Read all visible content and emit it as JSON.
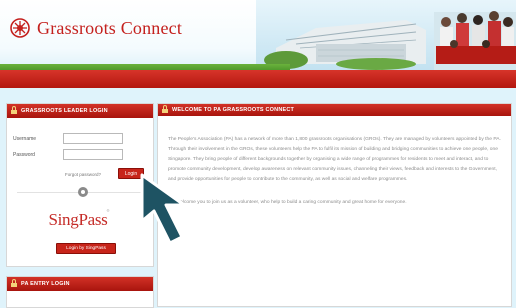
{
  "header": {
    "site_name": "Grassroots Connect"
  },
  "login_panel": {
    "title": "GRASSROOTS LEADER LOGIN",
    "username_label": "Username",
    "password_label": "Password",
    "forgot_text": "Forgot password?",
    "login_button": "Login",
    "singpass_logo": "SingPass",
    "singpass_button": "Login by SingPass"
  },
  "second_panel": {
    "title": "PA ENTRY LOGIN"
  },
  "welcome_panel": {
    "title": "WELCOME TO PA GRASSROOTS CONNECT",
    "paragraph_1": "The People's Association (PA) has a network of more than 1,800 grassroots organisations (GROs). They are managed by volunteers appointed by the PA. Through their involvement in the GROs, these volunteers help the PA to fulfil its mission of building and bridging communities to achieve one people, one Singapore. They bring people of different backgrounds together by organising a wide range of programmes for residents to meet and interact, and to promote community development, develop awareness on relevant community issues, channeling their views, feedback and interests to the Government, and provide opportunities for people to contribute to the community, as well as social and welfare programmes.",
    "paragraph_2": "We welcome you to join us as a volunteer, who help to build a caring community and great home for everyone."
  },
  "colors": {
    "brand_red": "#c7241a",
    "background": "#dff3fb"
  }
}
